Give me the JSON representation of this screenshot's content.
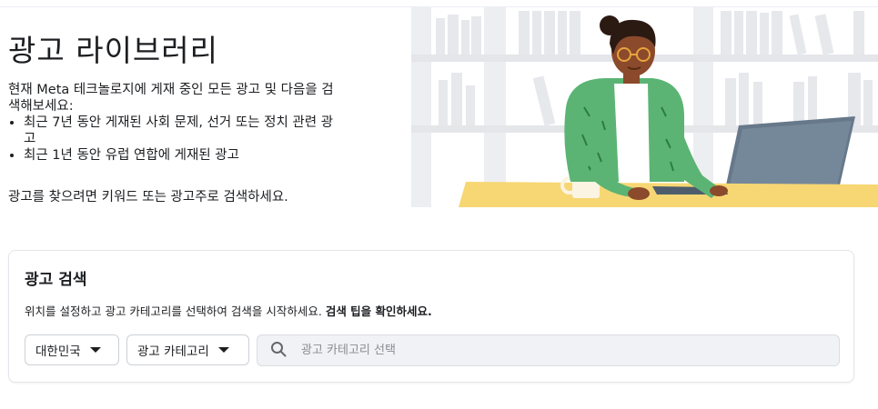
{
  "hero": {
    "title": "광고 라이브러리",
    "intro": "현재 Meta 테크놀로지에 게재 중인 모든 광고 및 다음을 검색해보세요:",
    "bullets": [
      "최근 7년 동안 게재된 사회 문제, 선거 또는 정치 관련 광고",
      "최근 1년 동안 유럽 연합에 게재된 광고"
    ],
    "hint": "광고를 찾으려면 키워드 또는 광고주로 검색하세요."
  },
  "search_card": {
    "title": "광고 검색",
    "description": "위치를 설정하고 광고 카테고리를 선택하여 검색을 시작하세요.",
    "tips_link": "검색 팁을 확인하세요.",
    "country": "대한민국",
    "category": "광고 카테고리",
    "search_placeholder": "광고 카테고리 선택",
    "search_value": ""
  },
  "icons": {
    "search": "search-icon",
    "caret": "caret-down-icon"
  },
  "colors": {
    "card_border": "#e4e6eb",
    "search_bg": "#f0f2f5",
    "desk": "#f7d774",
    "sweater": "#5bb474",
    "monitor": "#66788a"
  }
}
